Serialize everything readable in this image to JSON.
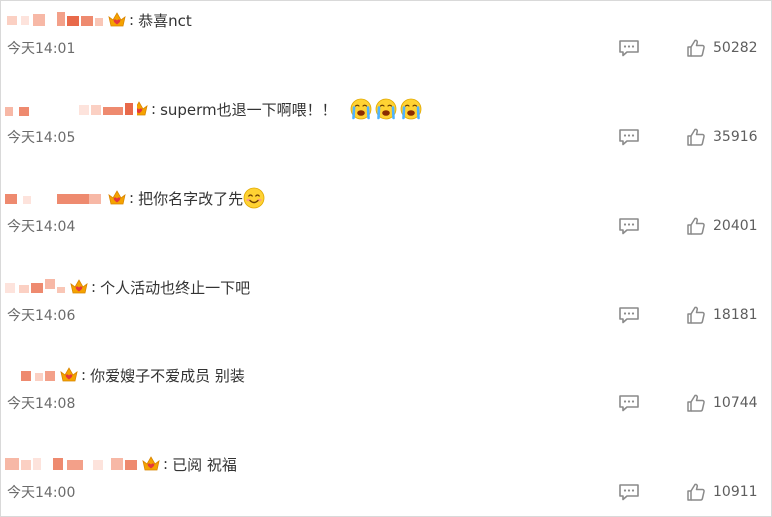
{
  "comments": [
    {
      "text": "恭喜nct",
      "time": "今天14:01",
      "likes": "50282",
      "emoji_count": 0,
      "emoji": ""
    },
    {
      "text": "superm也退一下啊喂！！",
      "time": "今天14:05",
      "likes": "35916",
      "emoji_count": 3,
      "emoji": "crying-face-emoji"
    },
    {
      "text": "把你名字改了先",
      "time": "今天14:04",
      "likes": "20401",
      "emoji_count": 1,
      "emoji": "smiling-face-emoji"
    },
    {
      "text": "个人活动也终止一下吧",
      "time": "今天14:06",
      "likes": "18181",
      "emoji_count": 0,
      "emoji": ""
    },
    {
      "text": "你爱嫂子不爱成员 别装",
      "time": "今天14:08",
      "likes": "10744",
      "emoji_count": 0,
      "emoji": ""
    },
    {
      "text": "已阅 祝福",
      "time": "今天14:00",
      "likes": "10911",
      "emoji_count": 0,
      "emoji": ""
    }
  ],
  "colors": {
    "text": "#333333",
    "meta": "#6b6b6b",
    "icon": "#8a8a8a",
    "mosaic": [
      "#fde3dc",
      "#f7b8a6",
      "#ee8a6f",
      "#e8694a"
    ],
    "crown": "#f5a300",
    "heart": "#e4393c"
  },
  "icons": {
    "reply": "comment-reply-icon",
    "like": "thumbs-up-icon",
    "badge": "fan-crown-badge-icon"
  }
}
